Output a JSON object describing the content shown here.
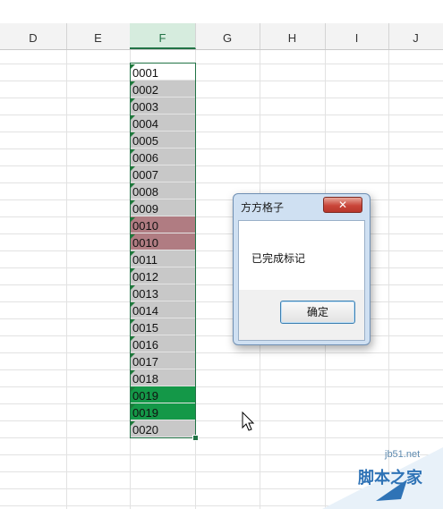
{
  "columns": [
    {
      "label": "D"
    },
    {
      "label": "E"
    },
    {
      "label": "F"
    },
    {
      "label": "G"
    },
    {
      "label": "H"
    },
    {
      "label": "I"
    },
    {
      "label": "J"
    }
  ],
  "active_column": "F",
  "cells": [
    {
      "value": "0001",
      "fill": "none"
    },
    {
      "value": "0002",
      "fill": "gray"
    },
    {
      "value": "0003",
      "fill": "gray"
    },
    {
      "value": "0004",
      "fill": "gray"
    },
    {
      "value": "0005",
      "fill": "gray"
    },
    {
      "value": "0006",
      "fill": "gray"
    },
    {
      "value": "0007",
      "fill": "gray"
    },
    {
      "value": "0008",
      "fill": "gray"
    },
    {
      "value": "0009",
      "fill": "gray"
    },
    {
      "value": "0010",
      "fill": "red"
    },
    {
      "value": "0010",
      "fill": "red"
    },
    {
      "value": "0011",
      "fill": "gray"
    },
    {
      "value": "0012",
      "fill": "gray"
    },
    {
      "value": "0013",
      "fill": "gray"
    },
    {
      "value": "0014",
      "fill": "gray"
    },
    {
      "value": "0015",
      "fill": "gray"
    },
    {
      "value": "0016",
      "fill": "gray"
    },
    {
      "value": "0017",
      "fill": "gray"
    },
    {
      "value": "0018",
      "fill": "gray"
    },
    {
      "value": "0019",
      "fill": "green"
    },
    {
      "value": "0019",
      "fill": "green"
    },
    {
      "value": "0020",
      "fill": "gray"
    }
  ],
  "colors": {
    "gray": "#c8c8c8",
    "red": "#b07c82",
    "green": "#149848",
    "selection": "#217346"
  },
  "dialog": {
    "title": "方方格子",
    "close_label": "✕",
    "message": "已完成标记",
    "ok_label": "确定"
  },
  "watermark": {
    "url": "jb51.net",
    "text": "脚本之家"
  }
}
